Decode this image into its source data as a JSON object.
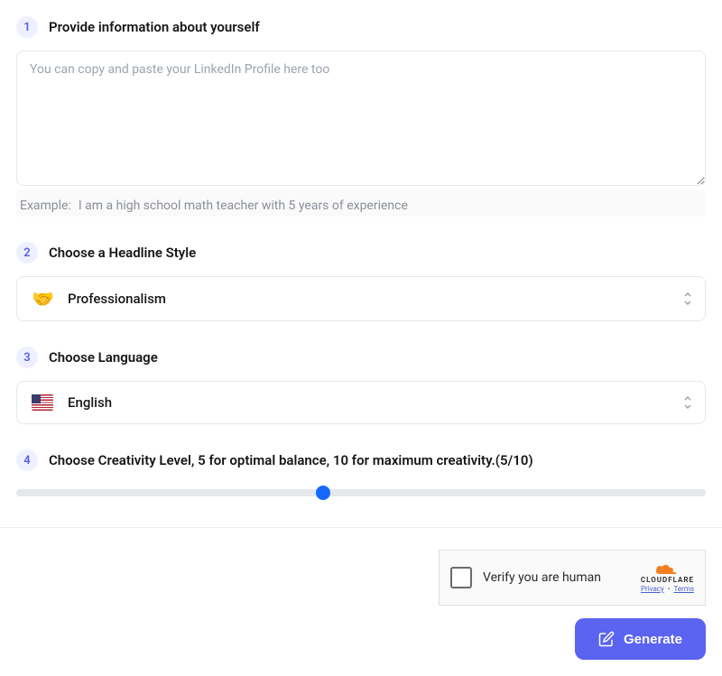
{
  "step1": {
    "number": "1",
    "title": "Provide information about yourself",
    "placeholder": "You can copy and paste your LinkedIn Profile here too",
    "value": "",
    "example_label": "Example:",
    "example_text": "I am a high school math teacher with 5 years of experience"
  },
  "step2": {
    "number": "2",
    "title": "Choose a Headline Style",
    "selected_icon": "handshake-emoji",
    "selected_label": "Professionalism"
  },
  "step3": {
    "number": "3",
    "title": "Choose Language",
    "selected_icon": "flag-us",
    "selected_label": "English"
  },
  "step4": {
    "number": "4",
    "title": "Choose Creativity Level, 5 for optimal balance, 10 for maximum creativity.(5/10)",
    "slider_value": 5,
    "slider_min": 0,
    "slider_max": 10
  },
  "captcha": {
    "text": "Verify you are human",
    "brand": "CLOUDFLARE",
    "privacy": "Privacy",
    "terms": "Terms"
  },
  "generate": {
    "label": "Generate"
  }
}
